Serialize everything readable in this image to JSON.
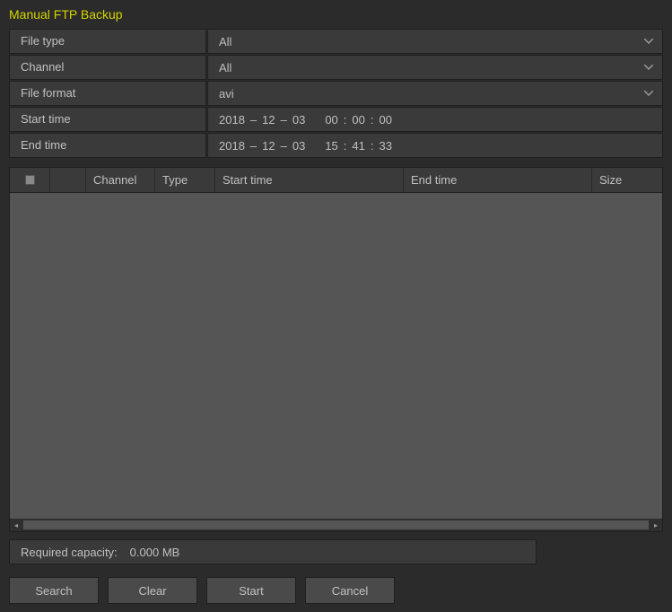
{
  "title": "Manual FTP Backup",
  "form": {
    "file_type": {
      "label": "File type",
      "value": "All"
    },
    "channel": {
      "label": "Channel",
      "value": "All"
    },
    "file_format": {
      "label": "File format",
      "value": "avi"
    },
    "start_time": {
      "label": "Start time",
      "year": "2018",
      "month": "12",
      "day": "03",
      "hour": "00",
      "min": "00",
      "sec": "00"
    },
    "end_time": {
      "label": "End time",
      "year": "2018",
      "month": "12",
      "day": "03",
      "hour": "15",
      "min": "41",
      "sec": "33"
    }
  },
  "table": {
    "headers": {
      "channel": "Channel",
      "type": "Type",
      "start": "Start time",
      "end": "End time",
      "size": "Size"
    }
  },
  "capacity": {
    "label": "Required capacity:",
    "value": "0.000 MB"
  },
  "buttons": {
    "search": "Search",
    "clear": "Clear",
    "start": "Start",
    "cancel": "Cancel"
  }
}
